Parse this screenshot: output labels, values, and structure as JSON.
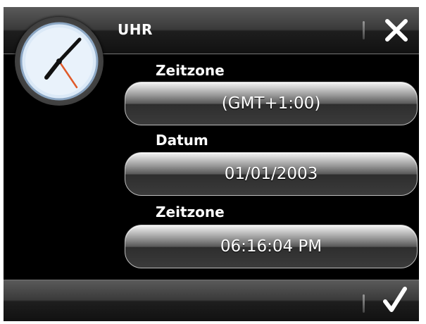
{
  "header": {
    "title": "UHR"
  },
  "fields": [
    {
      "label": "Zeitzone",
      "value": "(GMT+1:00)"
    },
    {
      "label": "Datum",
      "value": "01/01/2003"
    },
    {
      "label": "Zeitzone",
      "value": "06:16:04 PM"
    }
  ],
  "icons": {
    "close": "close-icon",
    "confirm": "checkmark-icon",
    "clock": "clock-icon"
  },
  "colors": {
    "background": "#000000",
    "bar": "#3a3a3a",
    "clock_face": "#dbe9f7",
    "second_hand": "#e05a2a",
    "text": "#ffffff"
  }
}
